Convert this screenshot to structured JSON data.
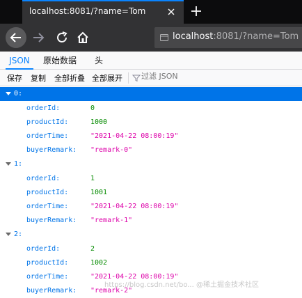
{
  "browser": {
    "tab_title": "localhost:8081/?name=Tom",
    "url_host": "localhost",
    "url_rest": ":8081/?name=Tom"
  },
  "viewer": {
    "tabs": [
      "JSON",
      "原始数据",
      "头"
    ],
    "toolbar": {
      "save": "保存",
      "copy": "复制",
      "collapse_all": "全部折叠",
      "expand_all": "全部展开",
      "filter_placeholder": "过滤 JSON"
    }
  },
  "orders": [
    {
      "index": "0:",
      "orderId": "0",
      "productId": "1000",
      "orderTime": "\"2021-04-22 08:00:19\"",
      "buyerRemark": "\"remark-0\""
    },
    {
      "index": "1:",
      "orderId": "1",
      "productId": "1001",
      "orderTime": "\"2021-04-22 08:00:19\"",
      "buyerRemark": "\"remark-1\""
    },
    {
      "index": "2:",
      "orderId": "2",
      "productId": "1002",
      "orderTime": "\"2021-04-22 08:00:19\"",
      "buyerRemark": "\"remark-2\""
    }
  ],
  "field_labels": {
    "orderId": "orderId:",
    "productId": "productId:",
    "orderTime": "orderTime:",
    "buyerRemark": "buyerRemark:"
  },
  "watermark": "https://blog.csdn.net/bo... @稀土掘金技术社区",
  "colors": {
    "accent": "#0a84ff",
    "selected_row": "#0074e8",
    "key": "#0074e8",
    "number": "#058b00",
    "string": "#dd00a9"
  }
}
